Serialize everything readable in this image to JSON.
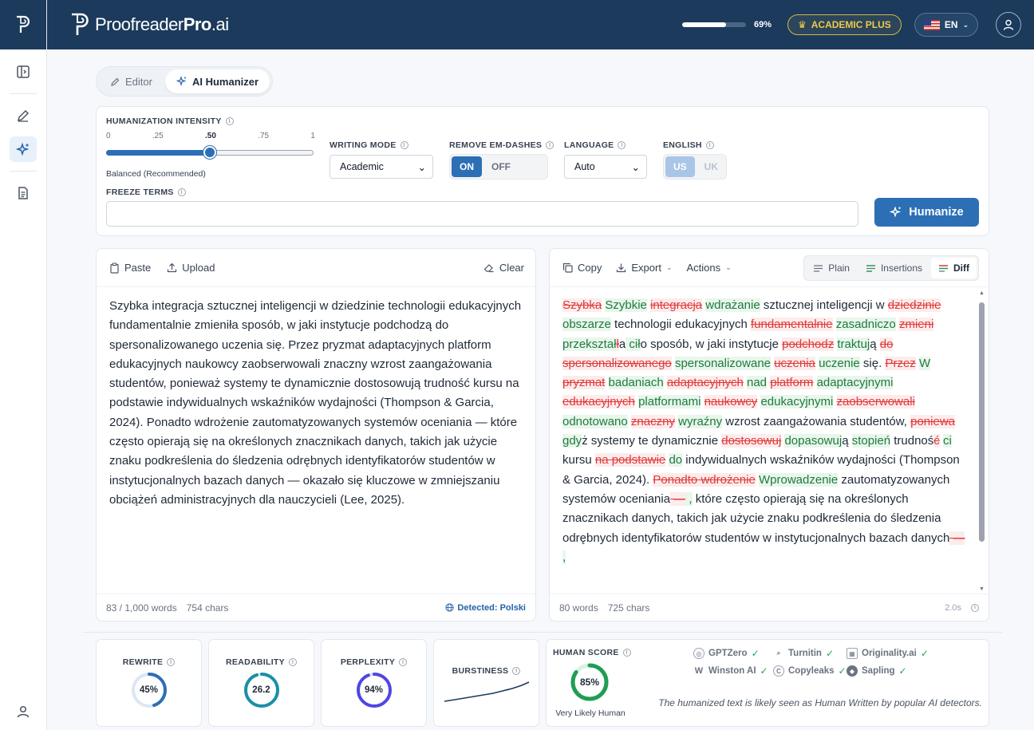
{
  "app": {
    "brand_regular": "Proofreader",
    "brand_bold": "Pro",
    "brand_suffix": ".ai",
    "usage_percent": 69,
    "usage_label": "69%",
    "plan_label": "ACADEMIC PLUS",
    "language_code": "EN",
    "colors": {
      "topbar": "#1b3a5c",
      "accent": "#2c6fb5",
      "plan": "#f0c94f",
      "insert": "#1f7a3d",
      "delete": "#e03a3a"
    }
  },
  "rail": {
    "items": [
      "toggle-sidebar-icon",
      "pencil-icon",
      "sparkles-icon",
      "document-icon",
      "user-icon"
    ]
  },
  "mode_tabs": [
    {
      "label": "Editor",
      "icon": "pencil-icon",
      "active": false
    },
    {
      "label": "AI Humanizer",
      "icon": "sparkles-icon",
      "active": true
    }
  ],
  "settings": {
    "intensity": {
      "label": "HUMANIZATION INTENSITY",
      "ticks": [
        "0",
        ".25",
        ".50",
        ".75",
        "1"
      ],
      "value": 0.5,
      "caption": "Balanced (Recommended)"
    },
    "writing_mode": {
      "label": "WRITING MODE",
      "value": "Academic"
    },
    "em_dashes": {
      "label": "REMOVE EM-DASHES",
      "on": "ON",
      "off": "OFF",
      "selected": "ON"
    },
    "language": {
      "label": "LANGUAGE",
      "value": "Auto"
    },
    "english": {
      "label": "ENGLISH",
      "us": "US",
      "uk": "UK",
      "selected": "US"
    },
    "freeze": {
      "label": "FREEZE TERMS",
      "value": "",
      "placeholder": ""
    },
    "humanize_label": "Humanize"
  },
  "input_panel": {
    "paste_label": "Paste",
    "upload_label": "Upload",
    "clear_label": "Clear",
    "text": "Szybka integracja sztucznej inteligencji w dziedzinie technologii edukacyjnych fundamentalnie zmieniła sposób, w jaki instytucje podchodzą do spersonalizowanego uczenia się. Przez pryzmat adaptacyjnych platform edukacyjnych naukowcy zaobserwowali znaczny wzrost zaangażowania studentów, ponieważ systemy te dynamicznie dostosowują trudność kursu na podstawie indywidualnych wskaźników wydajności (Thompson & Garcia, 2024). Ponadto wdrożenie zautomatyzowanych systemów oceniania — które często opierają się na określonych znacznikach danych, takich jak użycie znaku podkreślenia do śledzenia odrębnych identyfikatorów studentów w instytucjonalnych bazach danych — okazało się kluczowe w zmniejszaniu obciążeń administracyjnych dla nauczycieli (Lee, 2025).",
    "word_count": "83 / 1,000 words",
    "char_count": "754 chars",
    "detected": "Detected: Polski"
  },
  "output_panel": {
    "copy_label": "Copy",
    "export_label": "Export",
    "actions_label": "Actions",
    "view_tabs": [
      {
        "label": "Plain",
        "active": false
      },
      {
        "label": "Insertions",
        "active": false
      },
      {
        "label": "Diff",
        "active": true
      }
    ],
    "diff": [
      {
        "t": "del",
        "s": "Szybka"
      },
      {
        "t": "eq",
        "s": " "
      },
      {
        "t": "ins",
        "s": "Szybkie"
      },
      {
        "t": "eq",
        "s": " "
      },
      {
        "t": "del",
        "s": "integracja"
      },
      {
        "t": "eq",
        "s": " "
      },
      {
        "t": "ins",
        "s": "wdrażanie"
      },
      {
        "t": "eq",
        "s": " sztucznej inteligencji w "
      },
      {
        "t": "del",
        "s": "dziedzinie"
      },
      {
        "t": "eq",
        "s": " "
      },
      {
        "t": "ins",
        "s": "obszarze"
      },
      {
        "t": "eq",
        "s": " technologii edukacyjnych "
      },
      {
        "t": "del",
        "s": "fundamentalnie"
      },
      {
        "t": "eq",
        "s": " "
      },
      {
        "t": "ins",
        "s": "zasadniczo"
      },
      {
        "t": "eq",
        "s": " "
      },
      {
        "t": "del",
        "s": "zmieni"
      },
      {
        "t": "eq",
        "s": " "
      },
      {
        "t": "ins",
        "s": "przekształ"
      },
      {
        "t": "del",
        "s": "ł"
      },
      {
        "t": "eq",
        "s": "a"
      },
      {
        "t": "ins",
        "s": " cił"
      },
      {
        "t": "eq",
        "s": "o sposób, w jaki instytucje "
      },
      {
        "t": "del",
        "s": "podchodz"
      },
      {
        "t": "eq",
        "s": " "
      },
      {
        "t": "ins",
        "s": "traktuj"
      },
      {
        "t": "eq",
        "s": "ą "
      },
      {
        "t": "del",
        "s": "do spersonalizowanego"
      },
      {
        "t": "eq",
        "s": " "
      },
      {
        "t": "ins",
        "s": "spersonalizowane"
      },
      {
        "t": "eq",
        "s": " "
      },
      {
        "t": "del",
        "s": "uczenia"
      },
      {
        "t": "eq",
        "s": " "
      },
      {
        "t": "ins",
        "s": "uczenie"
      },
      {
        "t": "eq",
        "s": " się. "
      },
      {
        "t": "del",
        "s": "Przez"
      },
      {
        "t": "eq",
        "s": " "
      },
      {
        "t": "ins",
        "s": "W"
      },
      {
        "t": "eq",
        "s": " "
      },
      {
        "t": "del",
        "s": "pryzmat"
      },
      {
        "t": "eq",
        "s": " "
      },
      {
        "t": "ins",
        "s": "badaniach"
      },
      {
        "t": "eq",
        "s": " "
      },
      {
        "t": "del",
        "s": "adaptacyjnych"
      },
      {
        "t": "eq",
        "s": " "
      },
      {
        "t": "ins",
        "s": "nad"
      },
      {
        "t": "eq",
        "s": " "
      },
      {
        "t": "del",
        "s": "platform"
      },
      {
        "t": "eq",
        "s": " "
      },
      {
        "t": "ins",
        "s": "adaptacyjnymi"
      },
      {
        "t": "eq",
        "s": " "
      },
      {
        "t": "del",
        "s": "edukacyjnych"
      },
      {
        "t": "eq",
        "s": " "
      },
      {
        "t": "ins",
        "s": "platformami"
      },
      {
        "t": "eq",
        "s": " "
      },
      {
        "t": "del",
        "s": "naukowcy"
      },
      {
        "t": "eq",
        "s": " "
      },
      {
        "t": "ins",
        "s": "edukacyjnymi"
      },
      {
        "t": "eq",
        "s": " "
      },
      {
        "t": "del",
        "s": "zaobserwowali"
      },
      {
        "t": "eq",
        "s": " "
      },
      {
        "t": "ins",
        "s": "odnotowano"
      },
      {
        "t": "eq",
        "s": " "
      },
      {
        "t": "del",
        "s": "znaczny"
      },
      {
        "t": "eq",
        "s": " "
      },
      {
        "t": "ins",
        "s": "wyraźny"
      },
      {
        "t": "eq",
        "s": " wzrost zaangażowania studentów, "
      },
      {
        "t": "del",
        "s": "poniewa"
      },
      {
        "t": "eq",
        "s": " "
      },
      {
        "t": "ins",
        "s": "gdy"
      },
      {
        "t": "eq",
        "s": "ż systemy te dynamicznie "
      },
      {
        "t": "del",
        "s": "dostosowuj"
      },
      {
        "t": "eq",
        "s": " "
      },
      {
        "t": "ins",
        "s": "dopasowuj"
      },
      {
        "t": "eq",
        "s": "ą "
      },
      {
        "t": "ins",
        "s": "stopień"
      },
      {
        "t": "eq",
        "s": " trudnoś"
      },
      {
        "t": "del",
        "s": "ć"
      },
      {
        "t": "eq",
        "s": " "
      },
      {
        "t": "ins",
        "s": "ci"
      },
      {
        "t": "eq",
        "s": " kursu "
      },
      {
        "t": "del",
        "s": "na podstawie"
      },
      {
        "t": "eq",
        "s": " "
      },
      {
        "t": "ins",
        "s": "do"
      },
      {
        "t": "eq",
        "s": " indywidualnych wskaźników wydajności (Thompson & Garcia, 2024). "
      },
      {
        "t": "del",
        "s": "Ponadto wdrożenie"
      },
      {
        "t": "eq",
        "s": " "
      },
      {
        "t": "ins",
        "s": "Wprowadzenie"
      },
      {
        "t": "eq",
        "s": " zautomatyzowanych systemów oceniania"
      },
      {
        "t": "del",
        "s": " —"
      },
      {
        "t": "ins",
        "s": " ,"
      },
      {
        "t": "eq",
        "s": " które często opierają się na określonych znacznikach danych, takich jak użycie znaku podkreślenia do śledzenia odrębnych identyfikatorów studentów w instytucjonalnych bazach danych"
      },
      {
        "t": "del",
        "s": " —"
      },
      {
        "t": "ins",
        "s": " ,"
      }
    ],
    "word_count": "80 words",
    "char_count": "725 chars",
    "time": "2.0s"
  },
  "metrics": {
    "rewrite": {
      "label": "REWRITE",
      "value": 45,
      "display": "45%",
      "color": "#2c6fb5"
    },
    "readability": {
      "label": "READABILITY",
      "value": 26.2,
      "display": "26.2",
      "fraction": 0.95,
      "color": "#1b8fa6"
    },
    "perplexity": {
      "label": "PERPLEXITY",
      "value": 94,
      "display": "94%",
      "color": "#4f46e5"
    },
    "burstiness": {
      "label": "BURSTINESS"
    },
    "human": {
      "label": "HUMAN SCORE",
      "value": 85,
      "display": "85%",
      "verdict": "Very Likely Human",
      "color": "#1f9d55",
      "detectors": [
        {
          "name": "GPTZero",
          "icon": "gptzero-icon"
        },
        {
          "name": "Turnitin",
          "icon": "turnitin-icon"
        },
        {
          "name": "Originality.ai",
          "icon": "originality-icon"
        },
        {
          "name": "Winston AI",
          "icon": "winston-icon"
        },
        {
          "name": "Copyleaks",
          "icon": "copyleaks-icon"
        },
        {
          "name": "Sapling",
          "icon": "sapling-icon"
        }
      ],
      "note": "The humanized text is likely seen as Human Written by popular AI detectors."
    }
  }
}
